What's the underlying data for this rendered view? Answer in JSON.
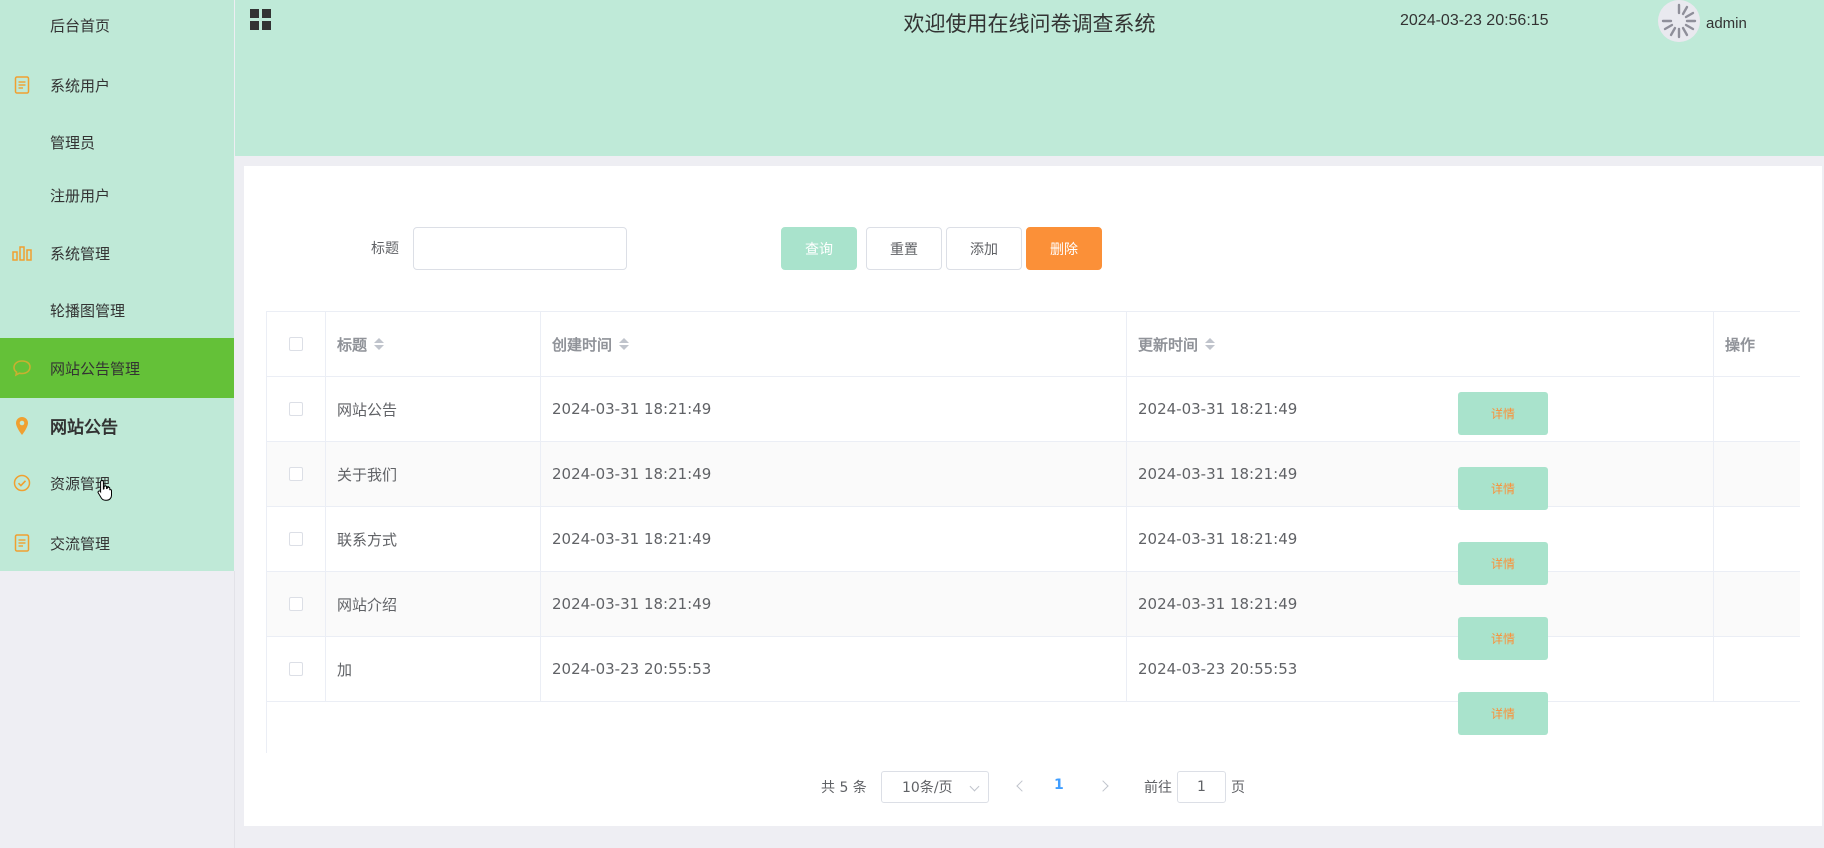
{
  "sidebar": {
    "items": [
      {
        "label": "后台首页",
        "icon": "none"
      },
      {
        "label": "系统用户",
        "icon": "document-icon"
      },
      {
        "label": "管理员",
        "icon": "none"
      },
      {
        "label": "注册用户",
        "icon": "none"
      },
      {
        "label": "系统管理",
        "icon": "bar-chart-icon"
      },
      {
        "label": "轮播图管理",
        "icon": "none"
      },
      {
        "label": "网站公告管理",
        "icon": "chat-icon"
      },
      {
        "label": "网站公告",
        "icon": "location-pin-icon"
      },
      {
        "label": "资源管理",
        "icon": "check-circle-icon"
      },
      {
        "label": "交流管理",
        "icon": "document-icon"
      }
    ],
    "active_index": 6
  },
  "header": {
    "title": "欢迎使用在线问卷调查系统",
    "datetime": "2024-03-23 20:56:15",
    "username": "admin"
  },
  "search": {
    "label": "标题",
    "value": "",
    "placeholder": ""
  },
  "toolbar": {
    "query_label": "查询",
    "reset_label": "重置",
    "add_label": "添加",
    "delete_label": "删除"
  },
  "table": {
    "columns": [
      "标题",
      "创建时间",
      "更新时间",
      "操作"
    ],
    "rows": [
      {
        "title": "网站公告",
        "created": "2024-03-31 18:21:49",
        "updated": "2024-03-31 18:21:49",
        "action": "详情"
      },
      {
        "title": "关于我们",
        "created": "2024-03-31 18:21:49",
        "updated": "2024-03-31 18:21:49",
        "action": "详情"
      },
      {
        "title": "联系方式",
        "created": "2024-03-31 18:21:49",
        "updated": "2024-03-31 18:21:49",
        "action": "详情"
      },
      {
        "title": "网站介绍",
        "created": "2024-03-31 18:21:49",
        "updated": "2024-03-31 18:21:49",
        "action": "详情"
      },
      {
        "title": "加",
        "created": "2024-03-23 20:55:53",
        "updated": "2024-03-23 20:55:53",
        "action": "详情"
      }
    ]
  },
  "pagination": {
    "total_text": "共 5 条",
    "page_size": "10条/页",
    "current_page": "1",
    "goto_label": "前往",
    "goto_value": "1",
    "page_unit": "页"
  },
  "colors": {
    "sidebar_bg": "#bfe9d7",
    "active_bg": "#64c138",
    "primary_light": "#a9e3cc",
    "danger": "#fb9038",
    "icon_accent": "#f0a030"
  }
}
